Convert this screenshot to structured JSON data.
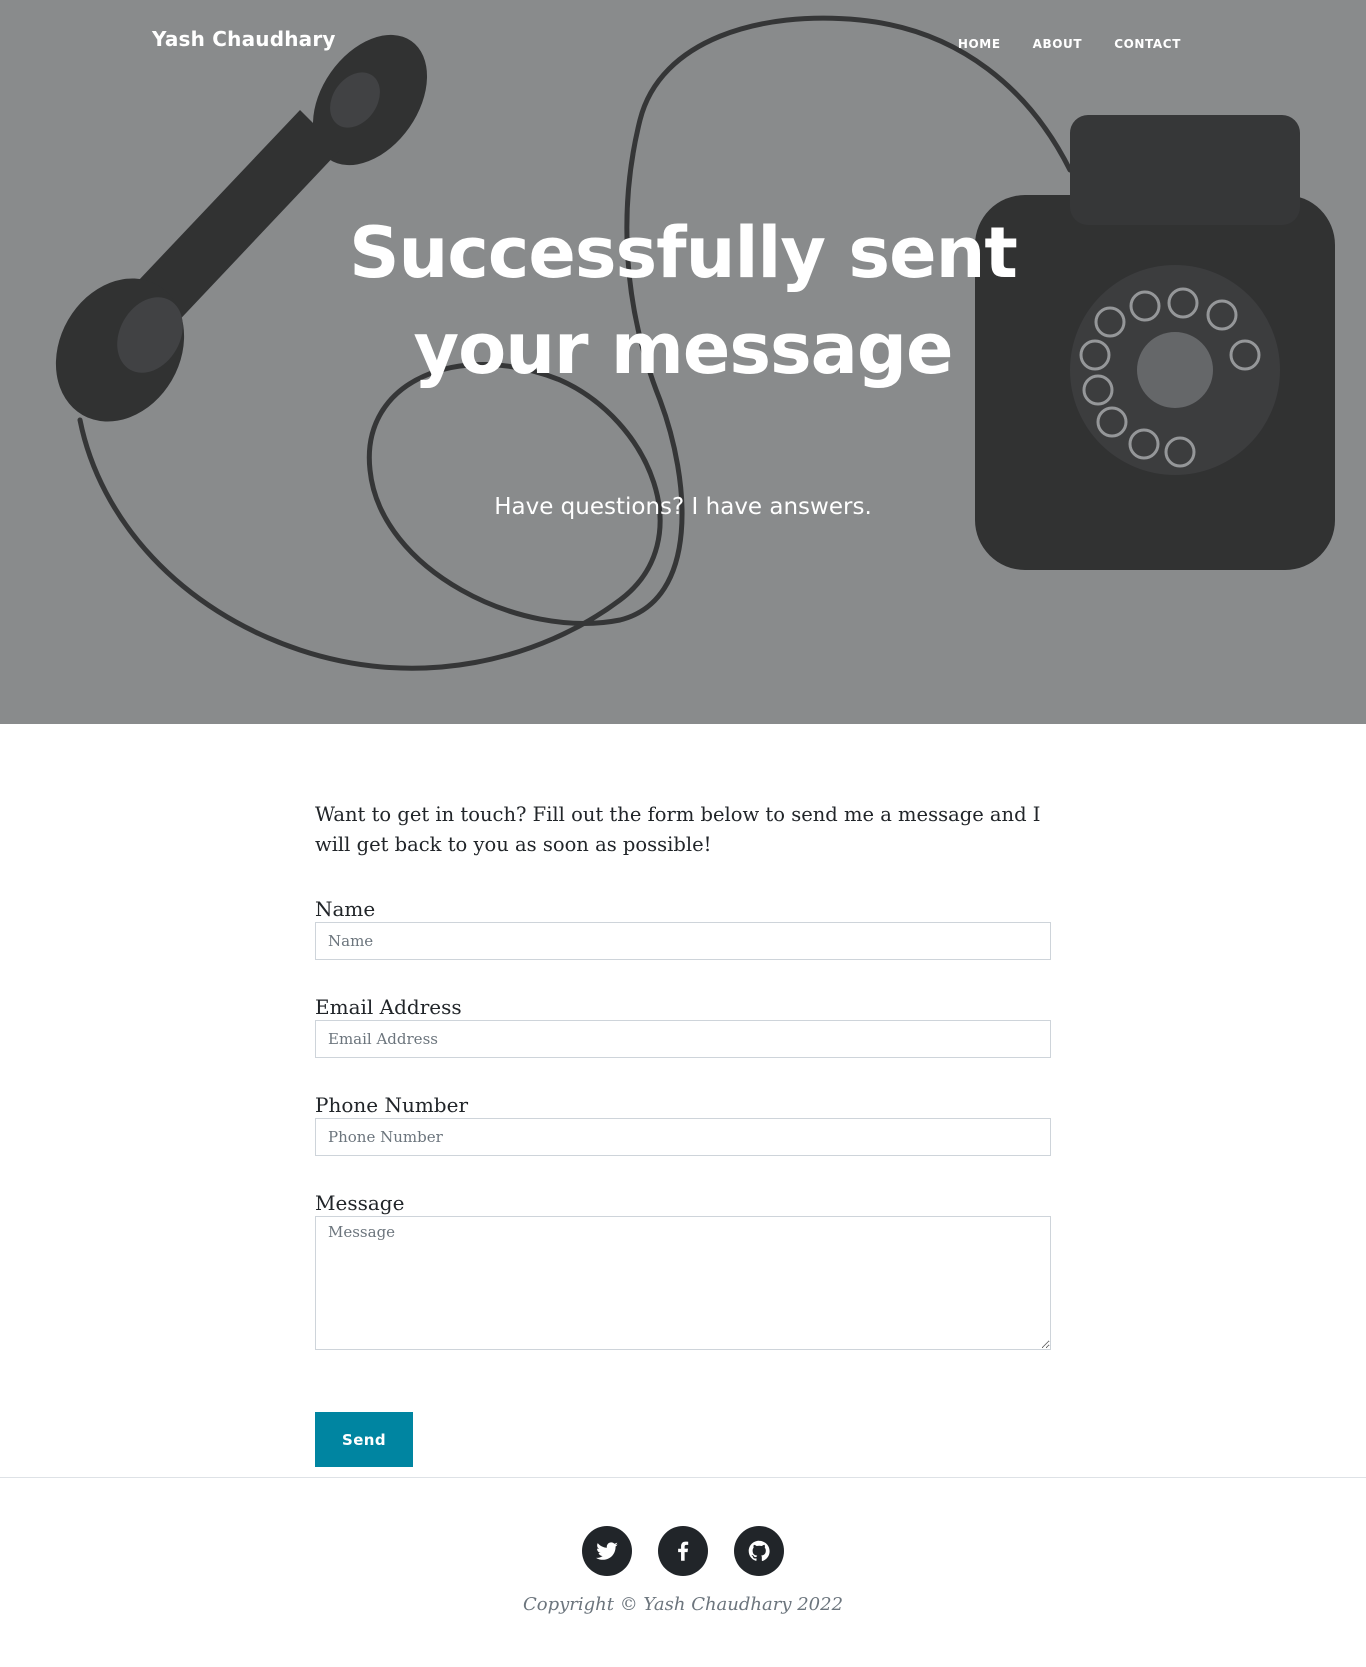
{
  "nav": {
    "brand": "Yash Chaudhary",
    "links": [
      {
        "label": "HOME"
      },
      {
        "label": "ABOUT"
      },
      {
        "label": "CONTACT"
      }
    ]
  },
  "hero": {
    "heading": "Successfully sent your message",
    "subheading": "Have questions? I have answers."
  },
  "form": {
    "intro": "Want to get in touch? Fill out the form below to send me a message and I will get back to you as soon as possible!",
    "fields": [
      {
        "label": "Name",
        "placeholder": "Name"
      },
      {
        "label": "Email Address",
        "placeholder": "Email Address"
      },
      {
        "label": "Phone Number",
        "placeholder": "Phone Number"
      },
      {
        "label": "Message",
        "placeholder": "Message"
      }
    ],
    "submit_label": "Send",
    "accent_color": "#0085a1"
  },
  "footer": {
    "social_icons": [
      "twitter-icon",
      "facebook-icon",
      "github-icon"
    ],
    "copyright": "Copyright © Yash Chaudhary 2022"
  }
}
